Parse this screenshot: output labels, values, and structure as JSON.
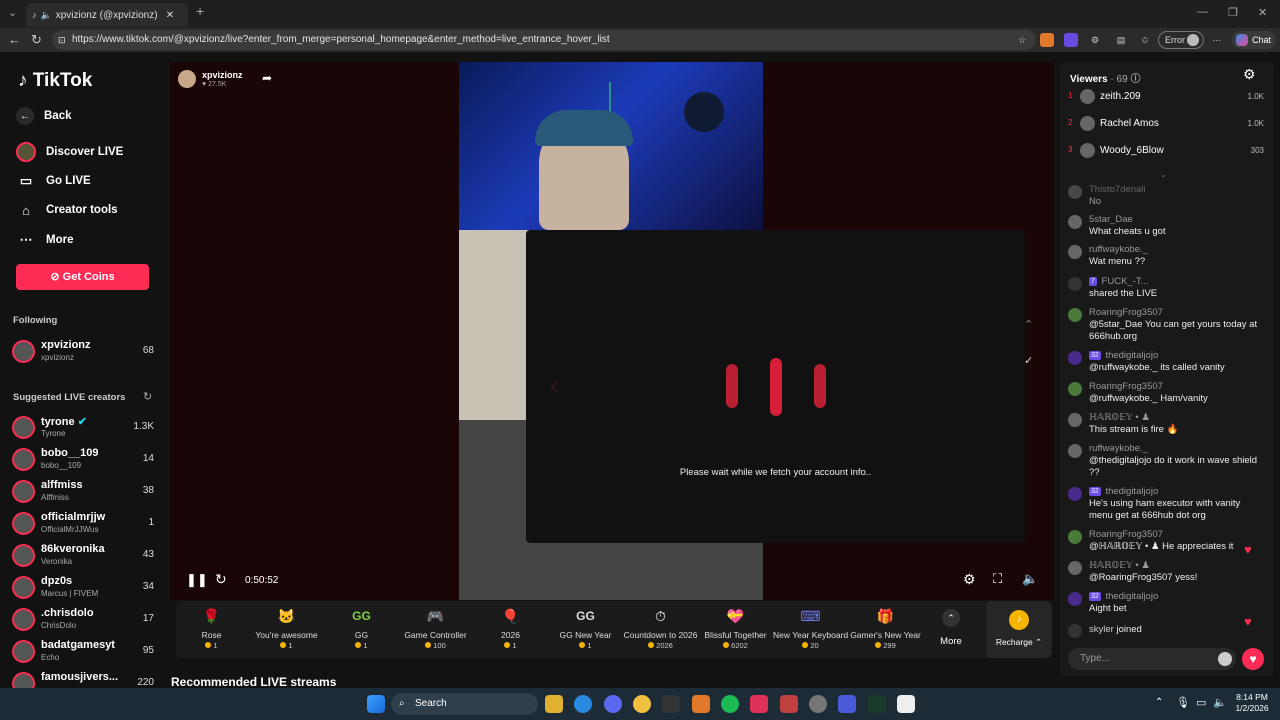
{
  "browser": {
    "tab_title": "xpvizionz (@xpvizionz) is LIVE",
    "url": "https://www.tiktok.com/@xpvizionz/live?enter_from_merge=personal_homepage&enter_method=live_entrance_hover_list",
    "error_label": "Error",
    "chat_label": "Chat"
  },
  "sidebar": {
    "logo": "TikTok",
    "nav": [
      {
        "label": "Back",
        "icon": "arrow-left-icon"
      },
      {
        "label": "Discover LIVE",
        "icon": "live-icon"
      },
      {
        "label": "Go LIVE",
        "icon": "camera-icon"
      },
      {
        "label": "Creator tools",
        "icon": "home-icon"
      },
      {
        "label": "More",
        "icon": "more-icon"
      }
    ],
    "get_coins": "Get Coins",
    "following_title": "Following",
    "following": [
      {
        "name": "xpvizionz",
        "sub": "xpvizionz",
        "count": "68"
      }
    ],
    "suggested_title": "Suggested LIVE creators",
    "suggested": [
      {
        "name": "tyrone",
        "sub": "Tyrone",
        "count": "1.3K"
      },
      {
        "name": "bobo__109",
        "sub": "bobo__109",
        "count": "14"
      },
      {
        "name": "alffmiss",
        "sub": "Alffmiss",
        "count": "38"
      },
      {
        "name": "officialmrjjw",
        "sub": "OfficialMrJJWus",
        "count": "1"
      },
      {
        "name": "86kveronika",
        "sub": "Veronika",
        "count": "43"
      },
      {
        "name": "dpz0s",
        "sub": "Marcus | FIVEM",
        "count": "34"
      },
      {
        "name": ".chrisdolo",
        "sub": "ChrisDolo",
        "count": "17"
      },
      {
        "name": "badatgamesyt",
        "sub": "Echo",
        "count": "95"
      },
      {
        "name": "famousjivers...",
        "sub": "",
        "count": "220"
      }
    ]
  },
  "stream": {
    "host_name": "xpvizionz",
    "host_likes": "27.5K",
    "elapsed": "0:50:52",
    "modal_text": "Please wait while we fetch your account info.."
  },
  "gifts": [
    {
      "name": "Rose",
      "price": "1",
      "color": "#e0304a",
      "glyph": "🌹"
    },
    {
      "name": "You're awesome",
      "price": "1",
      "color": "#c98a4a",
      "glyph": "🐱"
    },
    {
      "name": "GG",
      "price": "1",
      "color": "#7fd14a",
      "glyph": "GG"
    },
    {
      "name": "Game Controller",
      "price": "100",
      "color": "#8a8ad8",
      "glyph": "🎮"
    },
    {
      "name": "2026",
      "price": "1",
      "color": "#e94a9a",
      "glyph": "🎈"
    },
    {
      "name": "GG New Year",
      "price": "1",
      "color": "#dddddd",
      "glyph": "GG"
    },
    {
      "name": "Countdown to 2026",
      "price": "2026",
      "color": "#a06ad8",
      "glyph": "⏱"
    },
    {
      "name": "Blissful Together",
      "price": "6202",
      "color": "#d84a7a",
      "glyph": "💝"
    },
    {
      "name": "New Year Keyboard",
      "price": "20",
      "color": "#4a5ad8",
      "glyph": "⌨"
    },
    {
      "name": "Gamer's New Year",
      "price": "299",
      "color": "#4ab8d8",
      "glyph": "🎁"
    }
  ],
  "gift_more": "More",
  "recharge": "Recharge",
  "recommended_title": "Recommended LIVE streams",
  "chat": {
    "viewers_label": "Viewers",
    "viewers_count": "69",
    "top_viewers": [
      {
        "rank": "1",
        "name": "zeith.209",
        "score": "1.0K"
      },
      {
        "rank": "2",
        "name": "Rachel Amos",
        "score": "1.0K"
      },
      {
        "rank": "3",
        "name": "Woody_6Blow",
        "score": "303"
      }
    ],
    "messages": [
      {
        "user": "Thisto7denali",
        "text": "No"
      },
      {
        "user": "5star_Dae",
        "text": "What cheats u got"
      },
      {
        "user": "ruffwaykobe._",
        "text": "Wat menu ??"
      },
      {
        "user": "FUCK_-T...",
        "text": "shared the LIVE",
        "badge": "7"
      },
      {
        "user": "RoaringFrog3507",
        "text": "@5star_Dae You can get yours today at 666hub.org"
      },
      {
        "user": "thedigitaljojo",
        "text": "@ruffwaykobe._ its called vanity",
        "badge": "32"
      },
      {
        "user": "RoaringFrog3507",
        "text": "@ruffwaykobe._ Ham/vanity"
      },
      {
        "user": "ℍ𝔸ℝ𝕆𝔼𝕐 • ♟",
        "text": "This stream is fire 🔥"
      },
      {
        "user": "ruffwaykobe._",
        "text": "@thedigitaljojo do it work in wave shield ??"
      },
      {
        "user": "thedigitaljojo",
        "text": "He's using ham executor with vanity menu get at 666hub dot org",
        "badge": "32"
      },
      {
        "user": "RoaringFrog3507",
        "text": "@ℍ𝔸ℝ𝕆𝔼𝕐 • ♟  He appreciates it"
      },
      {
        "user": "ℍ𝔸ℝ𝕆𝔼𝕐 • ♟",
        "text": "@RoaringFrog3507 yess!"
      },
      {
        "user": "thedigitaljojo",
        "text": "Aight bet",
        "badge": "32"
      }
    ],
    "joined_user": "skyler",
    "joined_text": "joined",
    "input_placeholder": "Type..."
  },
  "taskbar": {
    "search_label": "Search",
    "time": "8:14 PM",
    "date": "1/2/2026"
  }
}
